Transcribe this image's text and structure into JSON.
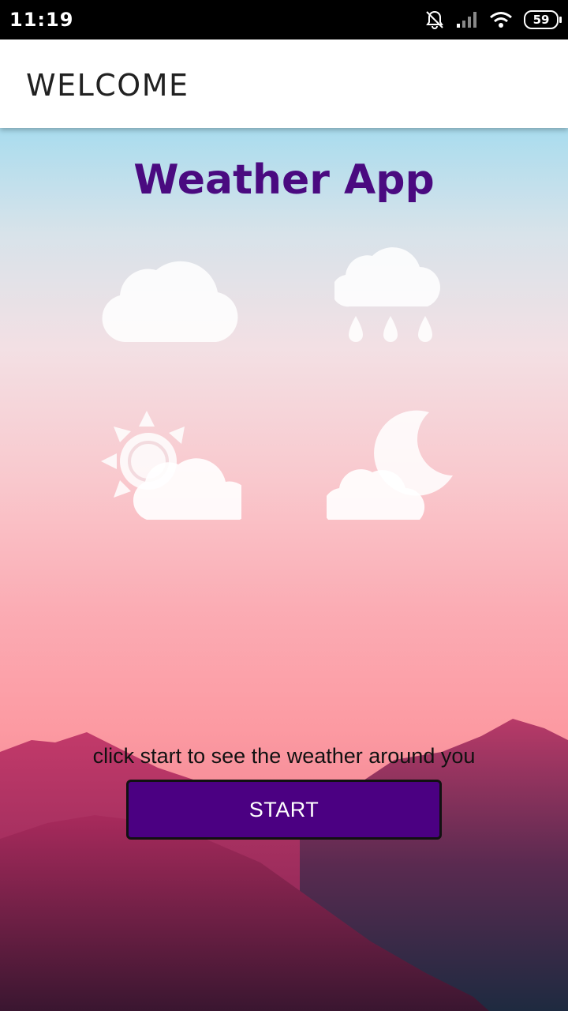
{
  "status_bar": {
    "time": "11:19",
    "battery_level": "59",
    "icons": [
      "notifications-off-icon",
      "signal-icon",
      "wifi-icon",
      "battery-icon"
    ]
  },
  "app_bar": {
    "title": "WELCOME"
  },
  "main": {
    "title": "Weather App",
    "weather_icons": [
      "cloud-icon",
      "rain-cloud-icon",
      "sun-cloud-icon",
      "moon-cloud-icon"
    ],
    "caption": "click start to see the weather around you",
    "start_label": "START"
  },
  "colors": {
    "title": "#4a0a80",
    "button_bg": "#4b0082",
    "app_bar_bg": "#ffffff",
    "status_bar_bg": "#000000"
  }
}
